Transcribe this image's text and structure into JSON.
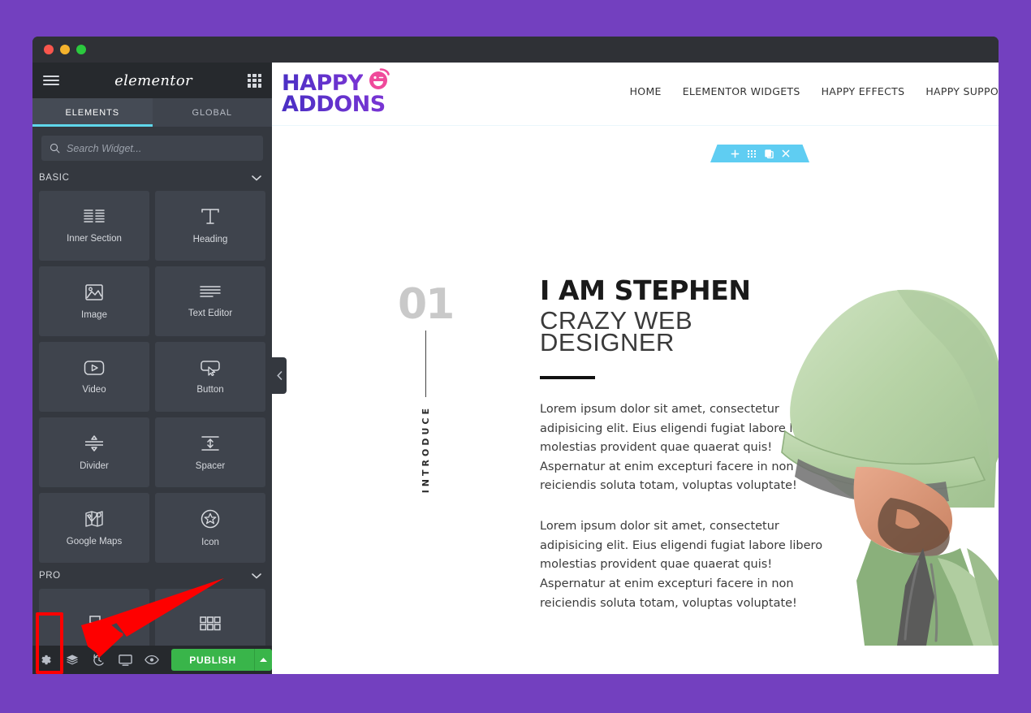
{
  "window": {
    "traffic_lights": [
      "close",
      "minimize",
      "maximize"
    ]
  },
  "panel": {
    "logo_text": "elementor",
    "tabs": [
      {
        "label": "ELEMENTS",
        "active": true
      },
      {
        "label": "GLOBAL",
        "active": false
      }
    ],
    "search": {
      "placeholder": "Search Widget...",
      "value": ""
    },
    "categories": [
      {
        "label": "BASIC",
        "expanded": true
      },
      {
        "label": "PRO",
        "expanded": true
      }
    ],
    "widgets": [
      {
        "label": "Inner Section",
        "icon": "inner-section-icon"
      },
      {
        "label": "Heading",
        "icon": "heading-icon"
      },
      {
        "label": "Image",
        "icon": "image-icon"
      },
      {
        "label": "Text Editor",
        "icon": "text-editor-icon"
      },
      {
        "label": "Video",
        "icon": "video-icon"
      },
      {
        "label": "Button",
        "icon": "button-icon"
      },
      {
        "label": "Divider",
        "icon": "divider-icon"
      },
      {
        "label": "Spacer",
        "icon": "spacer-icon"
      },
      {
        "label": "Google Maps",
        "icon": "google-maps-icon"
      },
      {
        "label": "Icon",
        "icon": "star-icon"
      }
    ],
    "footer": {
      "settings_icon": "gear-icon",
      "navigator_icon": "layers-icon",
      "history_icon": "history-icon",
      "responsive_icon": "monitor-icon",
      "preview_icon": "eye-icon",
      "publish_label": "PUBLISH",
      "publish_caret": "caret-up-icon",
      "publish_color": "#39b54a"
    },
    "collapse_handle": "chevron-left-icon"
  },
  "canvas": {
    "site": {
      "logo": {
        "line1": "HAPPY",
        "line2": "ADDONS"
      },
      "nav": [
        {
          "label": "HOME"
        },
        {
          "label": "ELEMENTOR WIDGETS"
        },
        {
          "label": "HAPPY EFFECTS"
        },
        {
          "label": "HAPPY SUPPO"
        }
      ]
    },
    "section_toolbar": {
      "color": "#5fcdf2",
      "actions": [
        {
          "name": "add-section",
          "icon": "plus-icon"
        },
        {
          "name": "drag-section",
          "icon": "grip-dots-icon"
        },
        {
          "name": "duplicate-section",
          "icon": "copy-icon"
        },
        {
          "name": "remove-section",
          "icon": "close-icon"
        }
      ]
    },
    "hero": {
      "number": "01",
      "vertical_label": "INTRODUCE",
      "title": "I AM STEPHEN",
      "subtitle": "CRAZY WEB DESIGNER",
      "paragraphs": [
        "Lorem ipsum dolor sit amet, consectetur adipisicing elit. Eius eligendi fugiat labore libero molestias provident quae quaerat quis! Aspernatur at enim excepturi facere in non reiciendis soluta totam, voluptas voluptate!",
        "Lorem ipsum dolor sit amet, consectetur adipisicing elit. Eius eligendi fugiat labore libero molestias provident quae quaerat quis! Aspernatur at enim excepturi facere in non reiciendis soluta totam, voluptas voluptate!"
      ],
      "photo_alt": "man-in-green-hoodie"
    }
  },
  "annotation": {
    "highlight_color": "#fe0000",
    "target": "settings-gear-button"
  }
}
